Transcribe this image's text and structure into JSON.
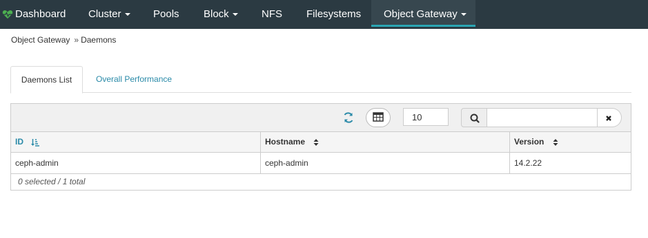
{
  "nav": {
    "brand_label": "Dashboard",
    "items": [
      {
        "label": "Cluster",
        "dropdown": true
      },
      {
        "label": "Pools",
        "dropdown": false
      },
      {
        "label": "Block",
        "dropdown": true
      },
      {
        "label": "NFS",
        "dropdown": false
      },
      {
        "label": "Filesystems",
        "dropdown": false
      },
      {
        "label": "Object Gateway",
        "dropdown": true,
        "active": true
      }
    ],
    "brand_icon": "heartbeat-icon",
    "brand_icon_color": "#4caf50",
    "active_color": "#2aa6b4"
  },
  "breadcrumb": {
    "parent": "Object Gateway",
    "separator": "»",
    "current": "Daemons"
  },
  "tabs": [
    {
      "label": "Daemons List",
      "active": true
    },
    {
      "label": "Overall Performance",
      "active": false
    }
  ],
  "toolbar": {
    "refresh_icon": "refresh-icon",
    "columns_icon": "table-icon",
    "page_limit": "10",
    "search_icon": "search-icon",
    "search_value": "",
    "clear_icon": "close-icon"
  },
  "table": {
    "columns": [
      {
        "label": "ID",
        "sort": "ascending"
      },
      {
        "label": "Hostname",
        "sort": "none"
      },
      {
        "label": "Version",
        "sort": "none"
      }
    ],
    "rows": [
      {
        "id": "ceph-admin",
        "hostname": "ceph-admin",
        "version": "14.2.22"
      }
    ],
    "footer": "0 selected / 1 total"
  }
}
